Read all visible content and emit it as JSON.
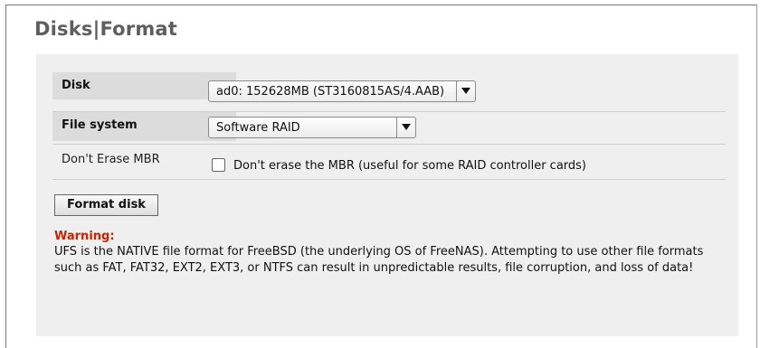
{
  "page": {
    "title": "Disks|Format"
  },
  "form": {
    "rows": [
      {
        "label": "Disk",
        "value": "ad0: 152628MB (ST3160815AS/4.AAB)"
      },
      {
        "label": "File system",
        "value": "Software RAID"
      },
      {
        "label": "Don't Erase MBR",
        "checkbox_label": "Don't erase the MBR (useful for some RAID controller cards)",
        "checked": false
      }
    ]
  },
  "actions": {
    "format_label": "Format disk"
  },
  "warning": {
    "title": "Warning:",
    "text": "UFS is the NATIVE file format for FreeBSD (the underlying OS of FreeNAS). Attempting to use other file formats such as FAT, FAT32, EXT2, EXT3, or NTFS can result in unpredictable results, file corruption, and loss of data!"
  },
  "colors": {
    "warning": "#cc2200",
    "panel": "#efefef",
    "label_bg": "#dcdcdc"
  }
}
